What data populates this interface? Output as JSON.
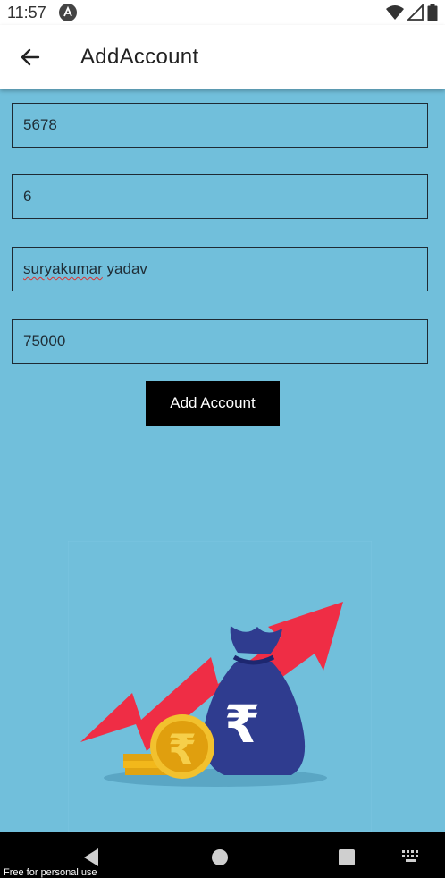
{
  "status_bar": {
    "time": "11:57",
    "app_icon": "app-notification-icon",
    "icons": [
      "wifi-icon",
      "signal-icon",
      "battery-icon"
    ]
  },
  "app_bar": {
    "title": "AddAccount",
    "back_icon": "arrow-left-icon"
  },
  "form": {
    "fields": [
      {
        "value": "5678"
      },
      {
        "value": "6"
      },
      {
        "value_part1": "suryakumar",
        "value_part2": " yadav"
      },
      {
        "value": "75000"
      }
    ],
    "submit_label": "Add Account"
  },
  "illustration": {
    "icon": "money-growth-illustration",
    "bag_symbol": "₹",
    "coin_symbol": "₹"
  },
  "nav_bar": {
    "icons": [
      "nav-back-icon",
      "nav-home-icon",
      "nav-recents-icon",
      "keyboard-icon"
    ]
  },
  "watermark": "Free for personal use",
  "colors": {
    "content_bg": "#71bfdb",
    "button_bg": "#000000",
    "arrow_red": "#ef2d45",
    "bag_blue": "#2f3c8f",
    "coin_gold": "#f2b81b"
  }
}
